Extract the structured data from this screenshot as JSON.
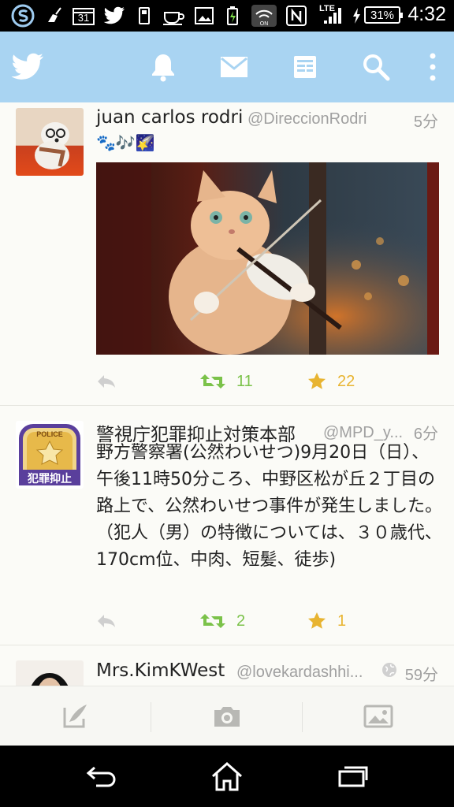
{
  "status_bar": {
    "calendar_day": "31",
    "network": "LTE",
    "battery": "31%",
    "time": "4:32"
  },
  "app_bar": {
    "icons": [
      "twitter-bird-icon",
      "bell-icon",
      "mail-icon",
      "lists-icon",
      "search-icon",
      "overflow-menu-icon"
    ]
  },
  "tweets": [
    {
      "name": "juan carlos rodri",
      "handle": "@DireccionRodri",
      "time": "5分",
      "text": "🐾🎶🌠",
      "retweets": "11",
      "favorites": "22"
    },
    {
      "name": "警視庁犯罪抑止対策本部",
      "handle": "@MPD_y...",
      "time": "6分",
      "text": "野方警察署(公然わいせつ)9月20日（日）、午後11時50分ころ、中野区松が丘２丁目の路上で、公然わいせつ事件が発生しました。（犯人（男）の特徴については、３０歳代、170cm位、中肉、短髪、徒歩)",
      "avatar_badge_top": "POLICE",
      "avatar_badge_bottom": "犯罪抑止",
      "retweets": "2",
      "favorites": "1"
    },
    {
      "name": "Mrs.KimKWest",
      "handle": "@lovekardashhi...",
      "time": "59分"
    }
  ],
  "colors": {
    "app_bar": "#a9d4f2",
    "retweet": "#7bc24a",
    "favorite": "#e8b431"
  }
}
